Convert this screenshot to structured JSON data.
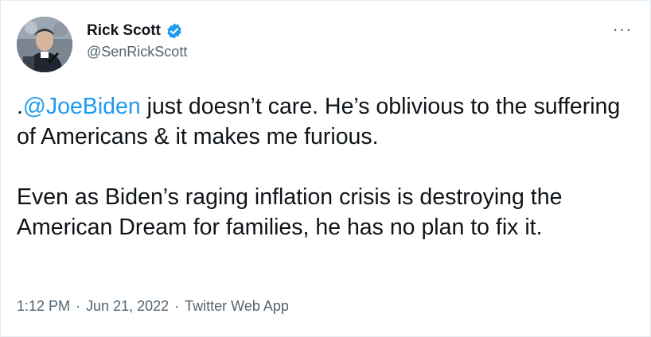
{
  "author": {
    "display_name": "Rick Scott",
    "handle": "@SenRickScott",
    "verified": true,
    "verified_color": "#1d9bf0"
  },
  "menu": {
    "more_icon": "more-horizontal-icon",
    "more_glyph": "···"
  },
  "tweet": {
    "paragraph_1_prefix": ".",
    "mention": "@JoeBiden",
    "paragraph_1_rest": " just doesn’t care. He’s oblivious to the suffering of Americans & it makes me furious.",
    "paragraph_2": "Even as Biden’s raging inflation crisis is destroying the American Dream for families, he has no plan to fix it."
  },
  "meta": {
    "time": "1:12 PM",
    "separator": "·",
    "date": "Jun 21, 2022",
    "source": "Twitter Web App"
  },
  "colors": {
    "text": "#0f1419",
    "secondary": "#536471",
    "link": "#1d9bf0"
  }
}
